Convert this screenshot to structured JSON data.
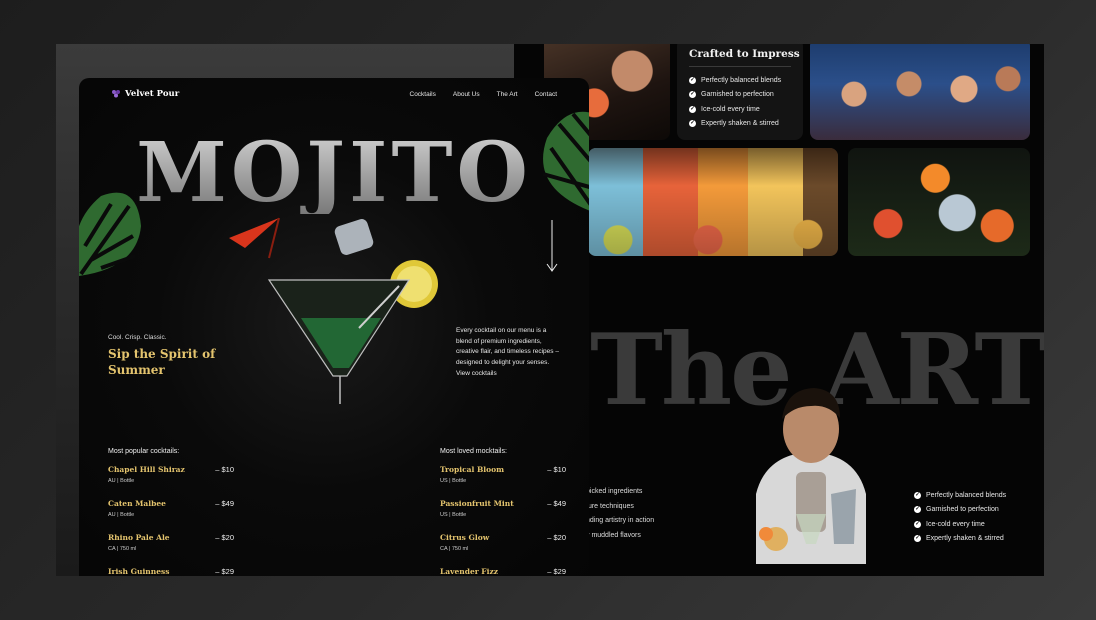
{
  "front_page": {
    "brand": "Velvet Pour",
    "nav": [
      "Cocktails",
      "About Us",
      "The Art",
      "Contact"
    ],
    "hero_word": "MOJITO",
    "tagline_small": "Cool. Crisp. Classic.",
    "tagline_big": "Sip the Spirit of Summer",
    "description": "Every cocktail on our menu is a blend of premium ingredients, creative flair, and timeless recipes – designed to delight your senses.",
    "view_link": "View cocktails",
    "popular_heading": "Most popular cocktails:",
    "mocktails_heading": "Most loved mocktails:",
    "popular": [
      {
        "name": "Chapel Hill Shiraz",
        "price": "– $10",
        "meta": "AU | Bottle"
      },
      {
        "name": "Caten Malbee",
        "price": "– $49",
        "meta": "AU | Bottle"
      },
      {
        "name": "Rhino Pale Ale",
        "price": "– $20",
        "meta": "CA | 750 ml"
      },
      {
        "name": "Irish Guinness",
        "price": "– $29",
        "meta": ""
      }
    ],
    "mocktails": [
      {
        "name": "Tropical Bloom",
        "price": "– $10",
        "meta": "US | Bottle"
      },
      {
        "name": "Passionfruit Mint",
        "price": "– $49",
        "meta": "US | Bottle"
      },
      {
        "name": "Citrus Glow",
        "price": "– $20",
        "meta": "CA | 750 ml"
      },
      {
        "name": "Lavender Fizz",
        "price": "– $29",
        "meta": ""
      }
    ],
    "colors": {
      "accent_gold": "#e4c46e",
      "background": "#050505"
    }
  },
  "back_page": {
    "crafted_title": "Crafted to Impress",
    "crafted_points": [
      "Perfectly balanced blends",
      "Garnished to perfection",
      "Ice-cold every time",
      "Expertly shaken & stirred"
    ],
    "art_heading": "The ART",
    "art_left_points": [
      "picked ingredients",
      "ture techniques",
      "nding artistry in action",
      "y muddled flavors"
    ],
    "art_right_points": [
      "Perfectly balanced blends",
      "Garnished to perfection",
      "Ice-cold every time",
      "Expertly shaken & stirred"
    ]
  }
}
